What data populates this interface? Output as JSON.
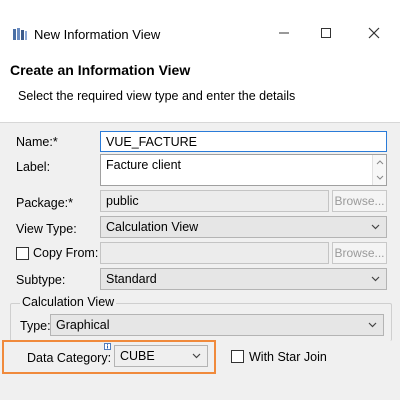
{
  "window": {
    "title": "New Information View",
    "icon": "information-view-icon",
    "controls": {
      "minimize": "—",
      "maximize": "☐",
      "close": "✕"
    }
  },
  "header": {
    "title": "Create an Information View",
    "description": "Select the required view type and enter the details"
  },
  "form": {
    "name": {
      "label": "Name:*",
      "value": "VUE_FACTURE"
    },
    "label_field": {
      "label": "Label:",
      "value": "Facture client"
    },
    "package": {
      "label": "Package:*",
      "value": "public",
      "browse": "Browse..."
    },
    "view_type": {
      "label": "View Type:",
      "value": "Calculation View"
    },
    "copy_from": {
      "label": "Copy From:",
      "value": "",
      "checked": false,
      "browse": "Browse..."
    },
    "subtype": {
      "label": "Subtype:",
      "value": "Standard"
    }
  },
  "calculation_view": {
    "group_label": "Calculation View",
    "type": {
      "label": "Type:",
      "value": "Graphical"
    },
    "data_category": {
      "label": "Data Category:",
      "value": "CUBE"
    },
    "star_join": {
      "label": "With Star Join",
      "checked": false
    }
  },
  "colors": {
    "highlight": "#f08a3c",
    "focus_border": "#2a7bd8",
    "body_bg": "#f0f0f0"
  }
}
